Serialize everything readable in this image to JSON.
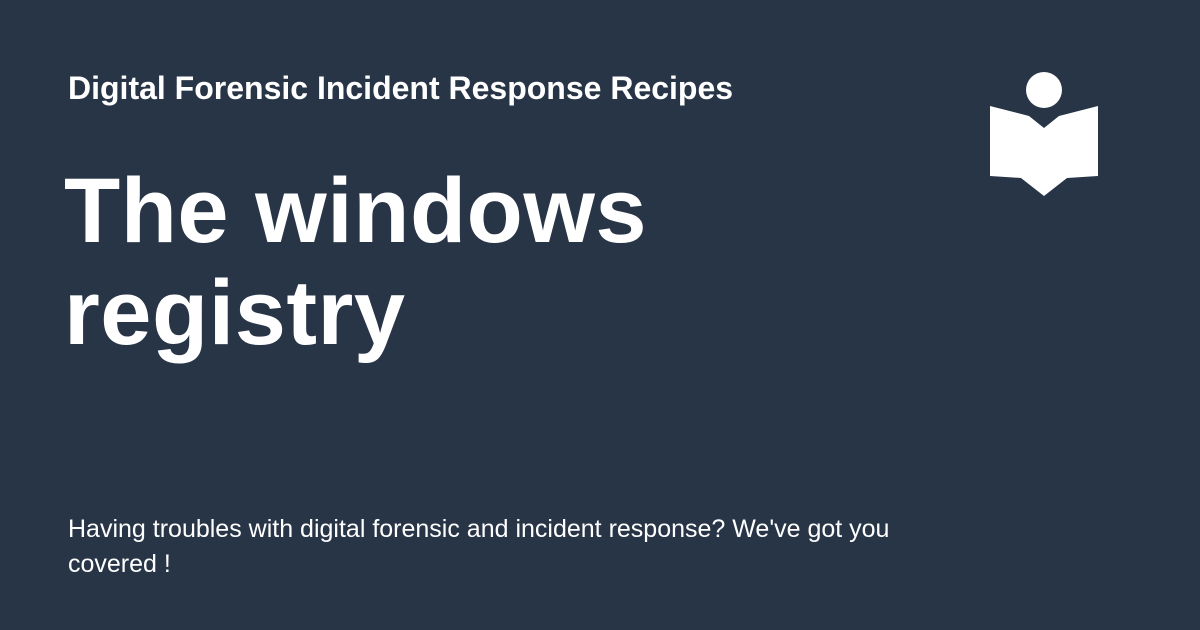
{
  "site": {
    "name": "Digital Forensic Incident Response Recipes",
    "logo_icon": "book-reader-icon"
  },
  "page": {
    "title": "The windows registry",
    "description": "Having troubles with digital forensic and incident response? We've got you covered !"
  },
  "colors": {
    "background": "#283547",
    "text": "#ffffff"
  }
}
